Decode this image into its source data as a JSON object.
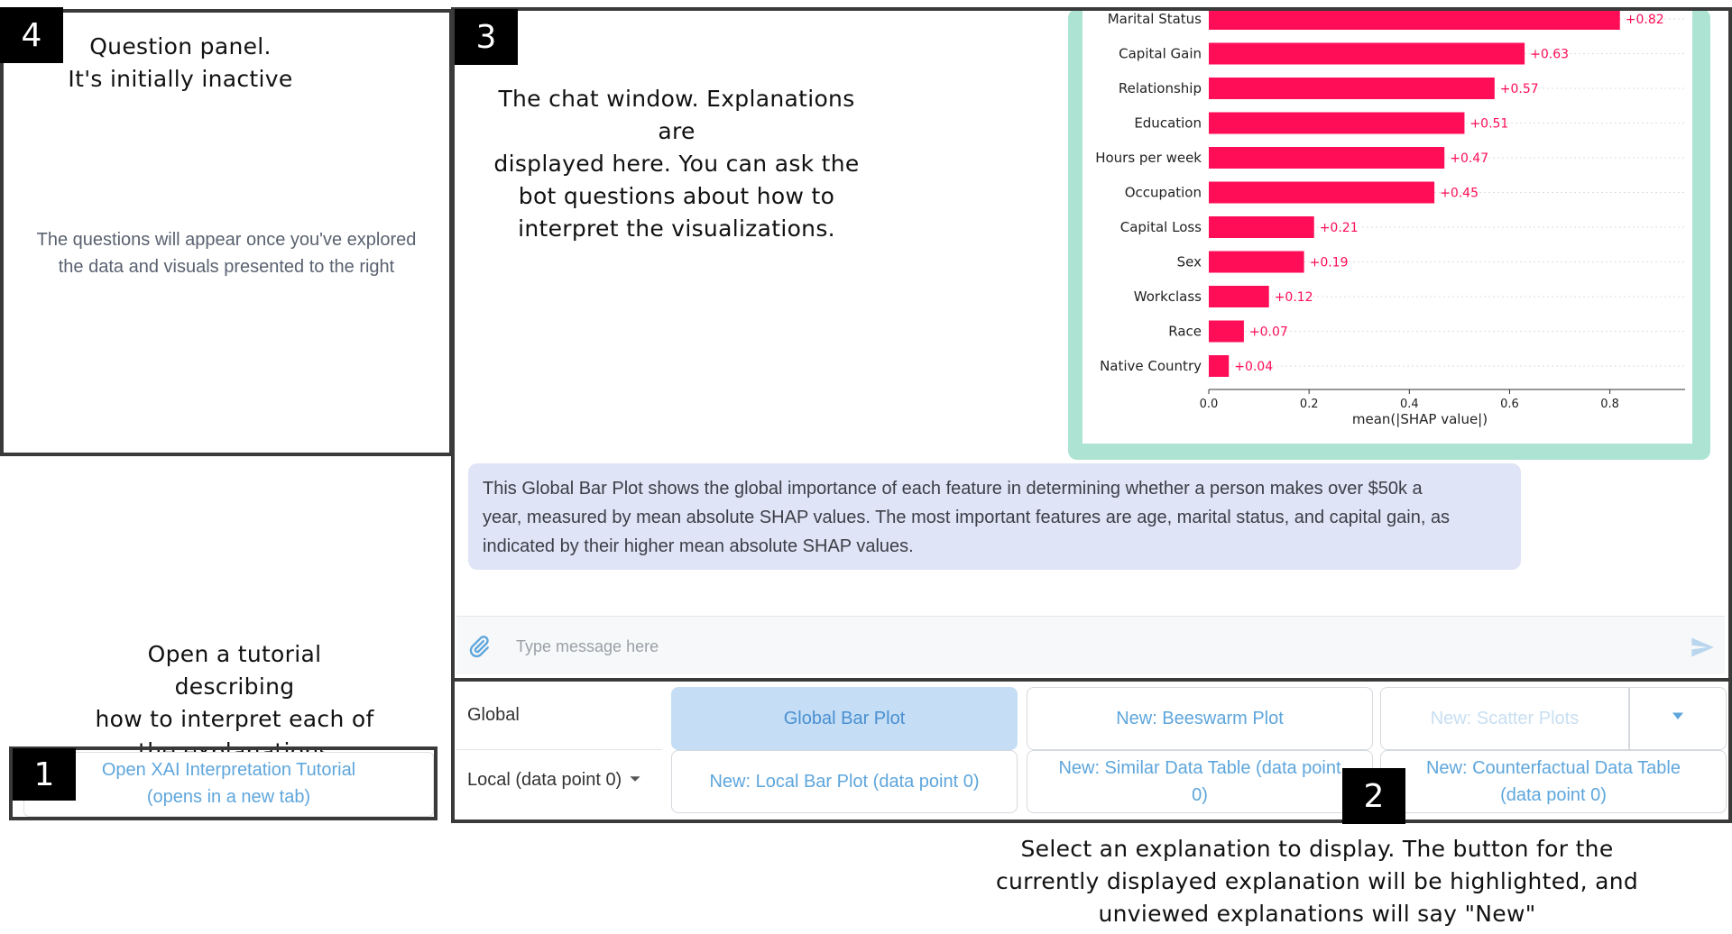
{
  "question_panel": {
    "badge": "4",
    "annotation_lines": [
      "Question panel.",
      "It's initially inactive"
    ],
    "message_lines": [
      "The questions will appear once you've explored",
      "the data and visuals presented to the right"
    ]
  },
  "tutorial": {
    "badge": "1",
    "annotation_lines": [
      "Open a tutorial describing",
      "how to interpret each of",
      "the explanations"
    ],
    "button_lines": [
      "Open XAI Interpretation Tutorial",
      "(opens in a new tab)"
    ]
  },
  "chat": {
    "badge": "3",
    "annotation_lines": [
      "The chat window. Explanations are",
      "displayed here. You can ask the",
      "bot questions about how to",
      "interpret the visualizations."
    ],
    "message_lines": [
      "This Global Bar Plot shows the global importance of each feature in determining whether a person makes over $50k a",
      "year, measured by mean absolute SHAP values. The most important features are age, marital status, and capital gain, as",
      "indicated by their higher mean absolute SHAP values."
    ],
    "input_placeholder": "Type message here",
    "icons": {
      "attach": "paperclip-icon",
      "send": "send-icon"
    }
  },
  "selector": {
    "badge": "2",
    "annotation_lines": [
      "Select an explanation to display. The button for the",
      "currently displayed explanation will be highlighted, and",
      "unviewed explanations will say \"New\""
    ],
    "global_label": "Global",
    "local_label": "Local (data point 0)",
    "global_buttons": [
      {
        "label": "Global Bar Plot"
      },
      {
        "label": "New: Beeswarm Plot"
      },
      {
        "label": "New: Scatter Plots"
      }
    ],
    "local_buttons": [
      {
        "label": "New: Local Bar Plot (data point 0)"
      },
      {
        "label": "New: Similar Data Table (data point",
        "label2": "0)"
      },
      {
        "label": "New: Counterfactual Data Table",
        "label2": "(data point 0)"
      }
    ]
  },
  "chart_data": {
    "type": "bar",
    "orientation": "horizontal",
    "categories": [
      "Marital Status",
      "Capital Gain",
      "Relationship",
      "Education",
      "Hours per week",
      "Occupation",
      "Capital Loss",
      "Sex",
      "Workclass",
      "Race",
      "Native Country"
    ],
    "values": [
      0.82,
      0.63,
      0.57,
      0.51,
      0.47,
      0.45,
      0.21,
      0.19,
      0.12,
      0.07,
      0.04
    ],
    "value_labels": [
      "+0.82",
      "+0.63",
      "+0.57",
      "+0.51",
      "+0.47",
      "+0.45",
      "+0.21",
      "+0.19",
      "+0.12",
      "+0.07",
      "+0.04"
    ],
    "xticks": [
      "0.0",
      "0.2",
      "0.4",
      "0.6",
      "0.8"
    ],
    "xlabel": "mean(|SHAP value|)",
    "xlim": [
      0,
      0.95
    ],
    "bar_color": "#ff0d57"
  },
  "colors": {
    "accent": "#5ea6dc",
    "active_bg": "#c5def5",
    "chat_bubble": "#dfe4f6",
    "plot_card": "#ace3d3",
    "bar": "#ff0d57"
  }
}
